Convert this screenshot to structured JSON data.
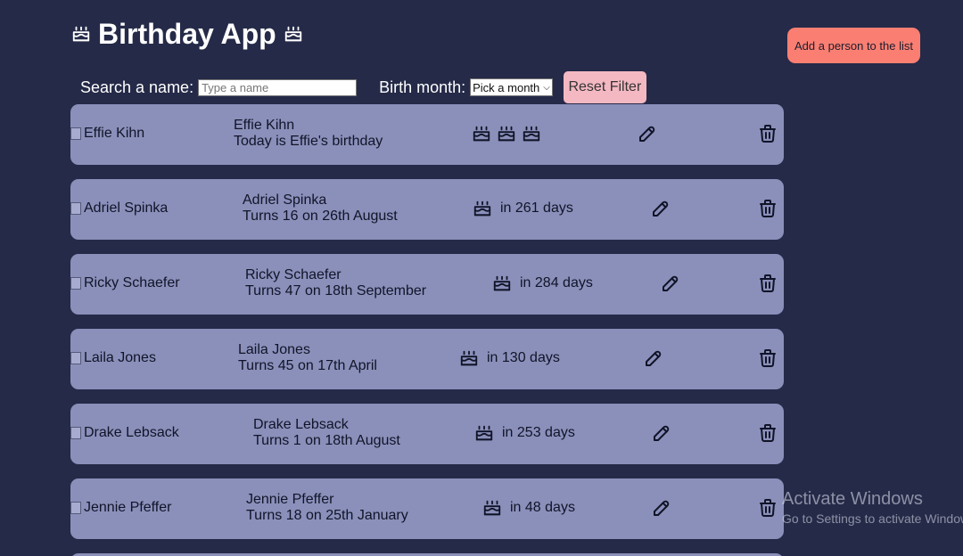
{
  "header": {
    "title": "Birthday App",
    "title_icon": "birthday-cake-icon"
  },
  "add_person_label": "Add a person to the list",
  "filters": {
    "search_label": "Search a name:",
    "search_placeholder": "Type a name",
    "search_value": "",
    "month_label": "Birth month:",
    "month_selected": "Pick a month",
    "reset_label": "Reset Filter"
  },
  "people": [
    {
      "img_alt": "Effie Kihn",
      "name": "Effie Kihn",
      "detail": "Today is Effie's birthday",
      "countdown": "",
      "cakes": 3
    },
    {
      "img_alt": "Adriel Spinka",
      "name": "Adriel Spinka",
      "detail": "Turns 16 on 26th August",
      "countdown": "in 261 days",
      "cakes": 1
    },
    {
      "img_alt": "Ricky Schaefer",
      "name": "Ricky Schaefer",
      "detail": "Turns 47 on 18th September",
      "countdown": "in 284 days",
      "cakes": 1
    },
    {
      "img_alt": "Laila Jones",
      "name": "Laila Jones",
      "detail": "Turns 45 on 17th April",
      "countdown": "in 130 days",
      "cakes": 1
    },
    {
      "img_alt": "Drake Lebsack",
      "name": "Drake Lebsack",
      "detail": "Turns 1 on 18th August",
      "countdown": "in 253 days",
      "cakes": 1
    },
    {
      "img_alt": "Jennie Pfeffer",
      "name": "Jennie Pfeffer",
      "detail": "Turns 18 on 25th January",
      "countdown": "in 48 days",
      "cakes": 1
    }
  ],
  "icons": {
    "edit": "pencil-icon",
    "delete": "trash-icon",
    "cake": "birthday-cake-icon"
  },
  "watermark": {
    "title": "Activate Windows",
    "subtitle": "Go to Settings to activate Windows."
  },
  "colors": {
    "background": "#252a48",
    "card": "#8a90ba",
    "add_button": "#fa7f72",
    "reset_button": "#f4b8c2"
  }
}
